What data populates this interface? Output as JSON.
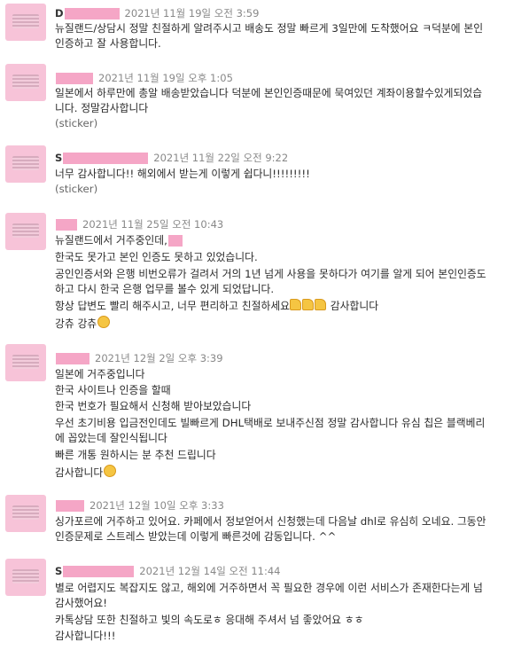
{
  "messages": [
    {
      "name": "D",
      "date": "2021년 11월 19일 오전 3:59",
      "lines": [
        "뉴질랜드/상담시 정말 친절하게 알려주시고 배송도 정말 빠르게 3일만에 도착했어요 ㅋ덕분에 본인",
        "인증하고 잘 사용합니다."
      ]
    },
    {
      "name": "",
      "date": "2021년 11월 19일 오후 1:05",
      "lines": [
        "일본에서 하루만에 총알 배송받았습니다 덕분에 본인인증때문에 묵여있던 계좌이용할수있게되었습",
        "니다. 정말감사합니다",
        "(sticker)"
      ]
    },
    {
      "name": "S",
      "date": "2021년 11월 22일 오전 9:22",
      "lines": [
        "너무 감사합니다!! 해외에서 받는게 이렇게 쉽다니!!!!!!!!!",
        "(sticker)"
      ]
    },
    {
      "name": "",
      "date": "2021년 11월 25일 오전 10:43",
      "lines": [
        "뉴질랜드에서 거주중인데,",
        "한국도 못가고 본인 인증도 못하고 있었습니다.",
        "공인인증서와 은행 비번오류가 걸려서 거의 1년 넘게 사용을 못하다가 여기를 알게 되어 본인인증도",
        "하고 다시 한국 은행 업무를 볼수 있게 되었답니다.",
        "항상 답변도 빨리 해주시고, 너무 편리하고 친절하세요",
        "강츄 강츄"
      ],
      "thanks": "감사합니다"
    },
    {
      "name": "",
      "date": "2021년 12월 2일 오후 3:39",
      "lines": [
        "일본에 거주중입니다",
        "한국 사이트나 인증을 할때",
        "한국 번호가 필요해서 신청해 받아보았습니다",
        "우선 초기비용 입금전인데도 빌빠르게 DHL택배로 보내주신점 정말 감사합니다 유심 칩은 블랙베리",
        "에 꼽았는데 잘인식됩니다",
        "빠른 개통 원하시는 분 추천 드립니다",
        "감사합니다"
      ]
    },
    {
      "name": "",
      "date": "2021년 12월 10일 오후 3:33",
      "lines": [
        "싱가포르에 거주하고 있어요. 카페에서 정보얻어서 신청했는데 다음날 dhl로 유심히 오네요. 그동안",
        "인증문제로 스트레스 받았는데 이렇게 빠른것에 감동입니다. ^^"
      ]
    },
    {
      "name": "S",
      "date": "2021년 12월 14일 오전 11:44",
      "lines": [
        "별로 어렵지도 복잡지도 않고, 해외에 거주하면서 꼭 필요한 경우에 이런 서비스가 존재한다는게 넘",
        "감사했어요!",
        "카톡상담 또한 친절하고 빛의 속도로ㅎ 응대해 주셔서 넘 좋았어요 ㅎㅎ",
        "감사합니다!!!"
      ]
    }
  ]
}
